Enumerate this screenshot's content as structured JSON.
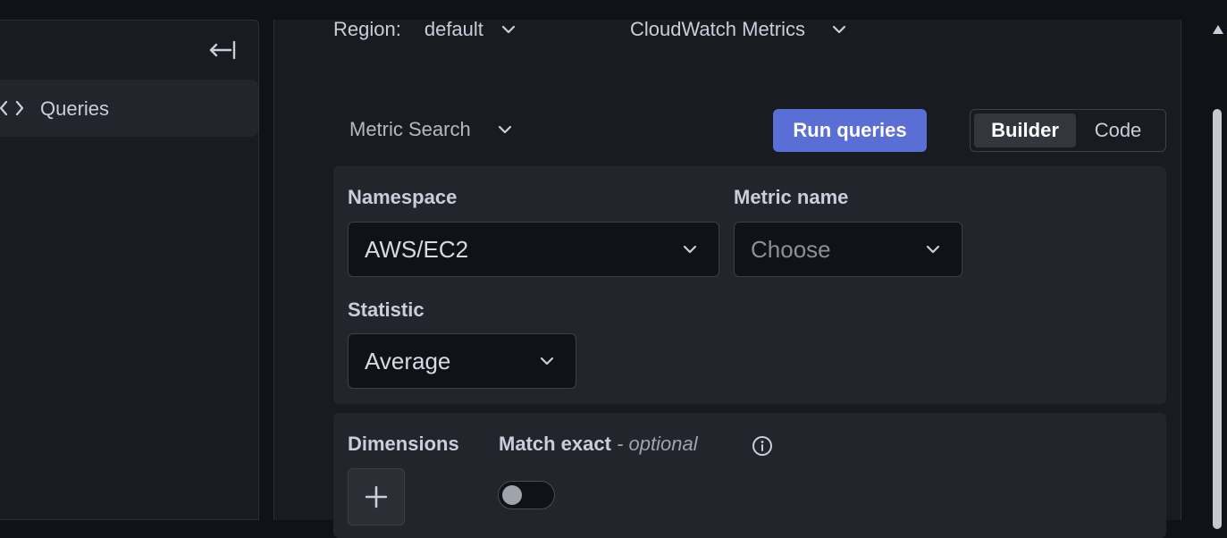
{
  "sidebar": {
    "collapse_icon": "collapse-left-icon",
    "items": [
      {
        "label": "Queries",
        "icon": "code-icon"
      }
    ]
  },
  "header": {
    "region_label": "Region:",
    "region_value": "default",
    "datasource_value": "CloudWatch Metrics"
  },
  "toolbar": {
    "mode_select": "Metric Search",
    "run_label": "Run queries",
    "modes": [
      "Builder",
      "Code"
    ],
    "active_mode": "Builder"
  },
  "builder": {
    "namespace_label": "Namespace",
    "namespace_value": "AWS/EC2",
    "metric_label": "Metric name",
    "metric_placeholder": "Choose",
    "statistic_label": "Statistic",
    "statistic_value": "Average",
    "dimensions_label": "Dimensions",
    "match_exact_label": "Match exact",
    "match_exact_suffix": "- optional",
    "match_exact_on": false
  },
  "colors": {
    "primary": "#5a6fd6",
    "background": "#181b1f",
    "card": "#22252b",
    "input": "#111217"
  }
}
